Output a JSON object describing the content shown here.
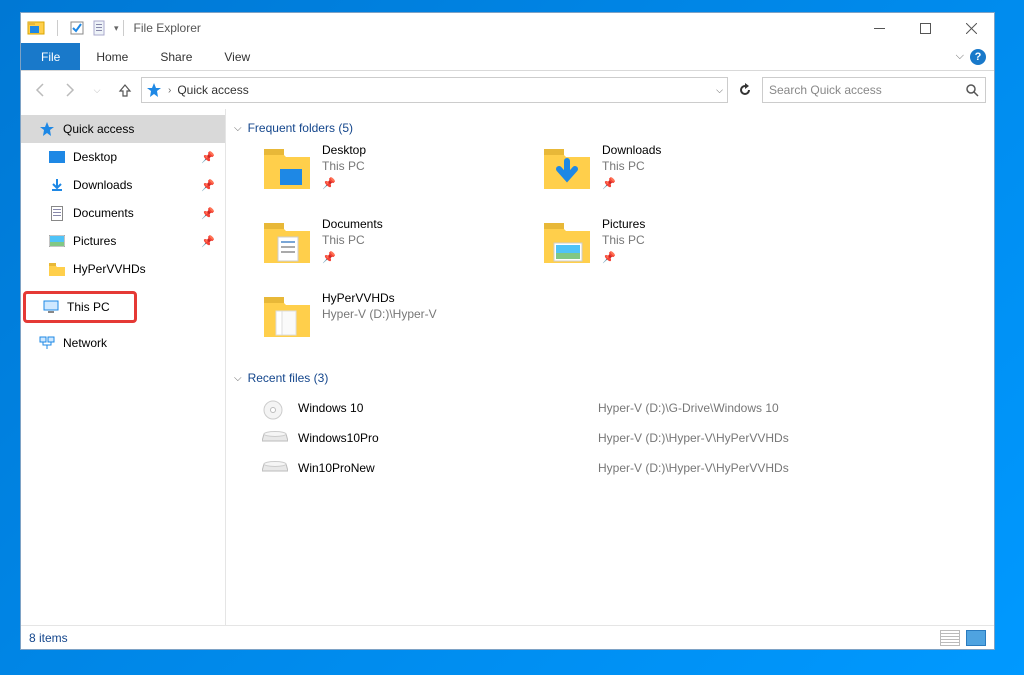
{
  "window": {
    "title": "File Explorer"
  },
  "ribbon": {
    "file": "File",
    "tabs": [
      "Home",
      "Share",
      "View"
    ]
  },
  "address": {
    "crumb": "Quick access"
  },
  "search": {
    "placeholder": "Search Quick access"
  },
  "sidebar": {
    "quick_access": "Quick access",
    "items": [
      {
        "label": "Desktop",
        "pinned": true
      },
      {
        "label": "Downloads",
        "pinned": true
      },
      {
        "label": "Documents",
        "pinned": true
      },
      {
        "label": "Pictures",
        "pinned": true
      },
      {
        "label": "HyPerVVHDs",
        "pinned": false
      }
    ],
    "this_pc": "This PC",
    "network": "Network"
  },
  "sections": {
    "frequent": {
      "label": "Frequent folders",
      "count": 5
    },
    "recent": {
      "label": "Recent files",
      "count": 3
    }
  },
  "folders": [
    {
      "name": "Desktop",
      "loc": "This PC",
      "pinned": true
    },
    {
      "name": "Downloads",
      "loc": "This PC",
      "pinned": true
    },
    {
      "name": "Documents",
      "loc": "This PC",
      "pinned": true
    },
    {
      "name": "Pictures",
      "loc": "This PC",
      "pinned": true
    },
    {
      "name": "HyPerVVHDs",
      "loc": "Hyper-V (D:)\\Hyper-V",
      "pinned": false
    }
  ],
  "files": [
    {
      "name": "Windows 10",
      "path": "Hyper-V (D:)\\G-Drive\\Windows 10"
    },
    {
      "name": "Windows10Pro",
      "path": "Hyper-V (D:)\\Hyper-V\\HyPerVVHDs"
    },
    {
      "name": "Win10ProNew",
      "path": "Hyper-V (D:)\\Hyper-V\\HyPerVVHDs"
    }
  ],
  "status": {
    "items": "8 items"
  }
}
